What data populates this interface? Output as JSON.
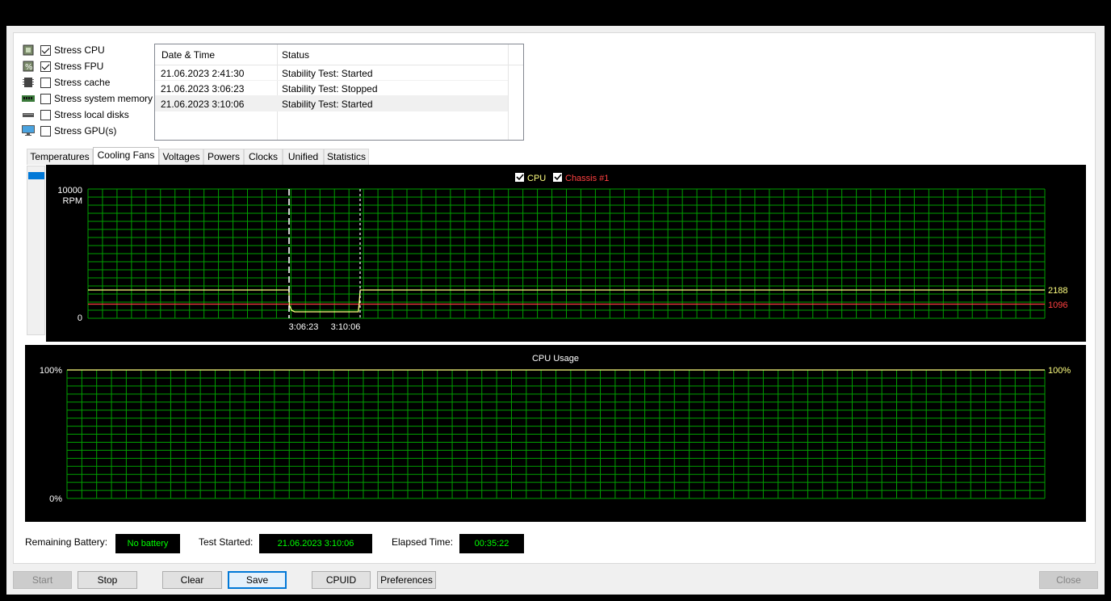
{
  "stress_options": [
    {
      "label": "Stress CPU",
      "checked": true,
      "icon": "cpu-chip-icon"
    },
    {
      "label": "Stress FPU",
      "checked": true,
      "icon": "fpu-percent-icon"
    },
    {
      "label": "Stress cache",
      "checked": false,
      "icon": "cache-chip-icon"
    },
    {
      "label": "Stress system memory",
      "checked": false,
      "icon": "memory-module-icon"
    },
    {
      "label": "Stress local disks",
      "checked": false,
      "icon": "disk-drive-icon"
    },
    {
      "label": "Stress GPU(s)",
      "checked": false,
      "icon": "monitor-icon"
    }
  ],
  "log": {
    "columns": [
      "Date & Time",
      "Status"
    ],
    "rows": [
      {
        "time": "21.06.2023 2:41:30",
        "status": "Stability Test: Started"
      },
      {
        "time": "21.06.2023 3:06:23",
        "status": "Stability Test: Stopped"
      },
      {
        "time": "21.06.2023 3:10:06",
        "status": "Stability Test: Started"
      }
    ],
    "selected_row": 2
  },
  "tabs": [
    {
      "label": "Temperatures",
      "active": false
    },
    {
      "label": "Cooling Fans",
      "active": true
    },
    {
      "label": "Voltages",
      "active": false
    },
    {
      "label": "Powers",
      "active": false
    },
    {
      "label": "Clocks",
      "active": false
    },
    {
      "label": "Unified",
      "active": false
    },
    {
      "label": "Statistics",
      "active": false
    }
  ],
  "chart_data": [
    {
      "type": "line",
      "title": "",
      "legend": [
        {
          "name": "CPU",
          "checked": true,
          "color": "#ffff80"
        },
        {
          "name": "Chassis #1",
          "checked": true,
          "color": "#ff4040"
        }
      ],
      "ylabel_top": "10000",
      "ylabel_unit": "RPM",
      "ylabel_bottom": "0",
      "ylim": [
        0,
        10000
      ],
      "x_markers": [
        "3:06:23",
        "3:10:06"
      ],
      "series": [
        {
          "name": "CPU",
          "color": "#ffff80",
          "x": [
            0,
            0.21,
            0.2105,
            0.213,
            0.216,
            0.258,
            0.2825,
            0.2835,
            0.2845,
            1.0
          ],
          "values": [
            2188,
            2188,
            1000,
            600,
            500,
            500,
            500,
            1200,
            2188,
            2188
          ],
          "current_label": "2188"
        },
        {
          "name": "Chassis #1",
          "color": "#ff4040",
          "x": [
            0,
            1.0
          ],
          "values": [
            1096,
            1096
          ],
          "current_label": "1096"
        }
      ],
      "grid": true,
      "grid_color": "#00a000"
    },
    {
      "type": "line",
      "title": "CPU Usage",
      "ylabel_top": "100%",
      "ylabel_bottom": "0%",
      "right_label": "100%",
      "ylim": [
        0,
        100
      ],
      "series": [
        {
          "name": "CPU Usage",
          "color": "#ffff80",
          "x": [
            0,
            1.0
          ],
          "values": [
            100,
            100
          ],
          "current_label": "100%"
        }
      ],
      "grid": true,
      "grid_color": "#00a000"
    }
  ],
  "status": {
    "battery_label": "Remaining Battery:",
    "battery_value": "No battery",
    "started_label": "Test Started:",
    "started_value": "21.06.2023 3:10:06",
    "elapsed_label": "Elapsed Time:",
    "elapsed_value": "00:35:22"
  },
  "buttons": [
    {
      "label": "Start",
      "enabled": false
    },
    {
      "label": "Stop",
      "enabled": true
    },
    {
      "label": "Clear",
      "enabled": true
    },
    {
      "label": "Save",
      "enabled": true,
      "focused": true
    },
    {
      "label": "CPUID",
      "enabled": true
    },
    {
      "label": "Preferences",
      "enabled": true
    },
    {
      "label": "Close",
      "enabled": false
    }
  ]
}
